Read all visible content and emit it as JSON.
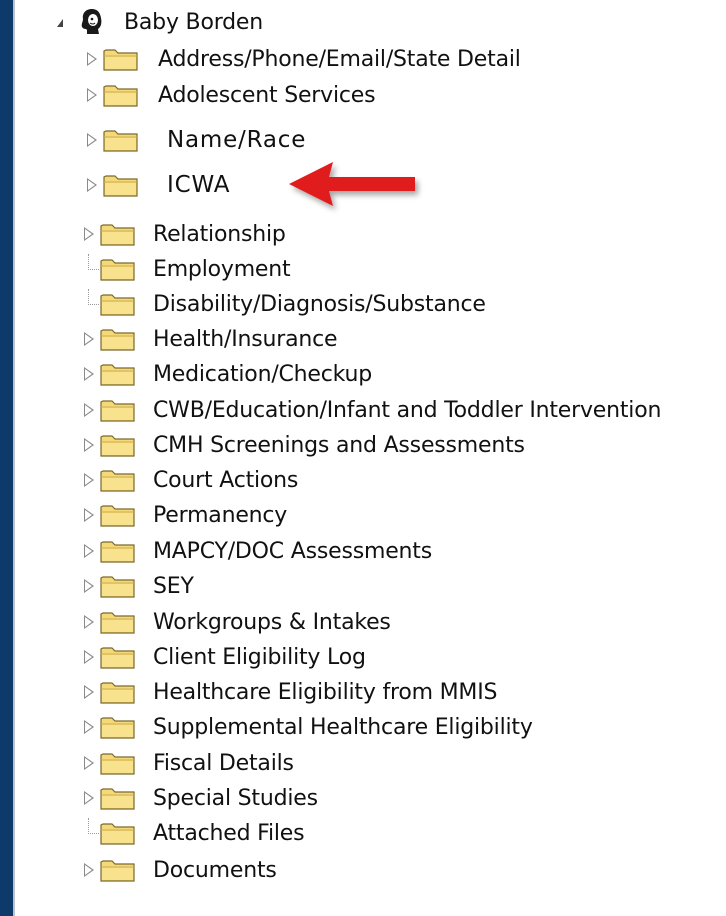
{
  "tree": {
    "root": {
      "label": "Baby Borden",
      "icon": "person-icon",
      "expanded": true
    },
    "items": [
      {
        "label": "Address/Phone/Email/State Detail",
        "expandable": true
      },
      {
        "label": "Adolescent Services",
        "expandable": true
      },
      {
        "label": "Name/Race",
        "expandable": true
      },
      {
        "label": "ICWA",
        "expandable": true
      },
      {
        "label": "Relationship",
        "expandable": true
      },
      {
        "label": "Employment",
        "expandable": false
      },
      {
        "label": "Disability/Diagnosis/Substance",
        "expandable": false
      },
      {
        "label": "Health/Insurance",
        "expandable": true
      },
      {
        "label": "Medication/Checkup",
        "expandable": true
      },
      {
        "label": "CWB/Education/Infant and Toddler Intervention",
        "expandable": true
      },
      {
        "label": "CMH Screenings and Assessments",
        "expandable": true
      },
      {
        "label": "Court Actions",
        "expandable": true
      },
      {
        "label": "Permanency",
        "expandable": true
      },
      {
        "label": "MAPCY/DOC Assessments",
        "expandable": true
      },
      {
        "label": "SEY",
        "expandable": true
      },
      {
        "label": "Workgroups & Intakes",
        "expandable": true
      },
      {
        "label": "Client Eligibility Log",
        "expandable": true
      },
      {
        "label": "Healthcare Eligibility from MMIS",
        "expandable": true
      },
      {
        "label": "Supplemental Healthcare Eligibility",
        "expandable": true
      },
      {
        "label": "Fiscal Details",
        "expandable": true
      },
      {
        "label": "Special Studies",
        "expandable": true
      },
      {
        "label": "Attached Files",
        "expandable": false
      },
      {
        "label": "Documents",
        "expandable": true
      }
    ]
  },
  "colors": {
    "background": "#0d3a6b",
    "panel": "#ffffff",
    "folder": "#f5d978",
    "arrow": "#e01b1b"
  }
}
